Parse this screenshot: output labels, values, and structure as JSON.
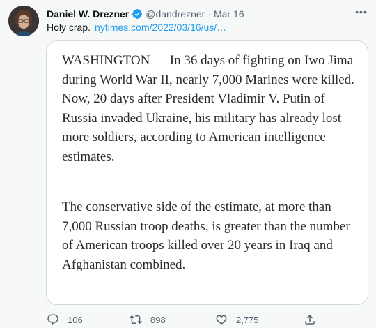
{
  "author": {
    "name": "Daniel W. Drezner",
    "handle": "@dandrezner",
    "separator": "·",
    "date": "Mar 16"
  },
  "tweet": {
    "text": "Holy crap.",
    "link": "nytimes.com/2022/03/16/us/…"
  },
  "quote": {
    "paragraph1": "WASHINGTON — In 36 days of fighting on Iwo Jima during World War II, nearly 7,000 Marines were killed. Now, 20 days after President Vladimir V. Putin of Russia invaded Ukraine, his military has already lost more soldiers, according to American intelligence estimates.",
    "paragraph2": "The conservative side of the estimate, at more than 7,000 Russian troop deaths, is greater than the number of American troops killed over 20 years in Iraq and Afghanistan combined."
  },
  "actions": {
    "reply_count": "106",
    "retweet_count": "898",
    "like_count": "2,775"
  },
  "colors": {
    "accent": "#1d9bf0",
    "muted": "#536471",
    "background": "#f7f9f9",
    "card_border": "#cfd9de"
  },
  "icons": [
    "avatar",
    "verified-badge-icon",
    "more-icon",
    "reply-icon",
    "retweet-icon",
    "like-icon",
    "share-icon"
  ]
}
